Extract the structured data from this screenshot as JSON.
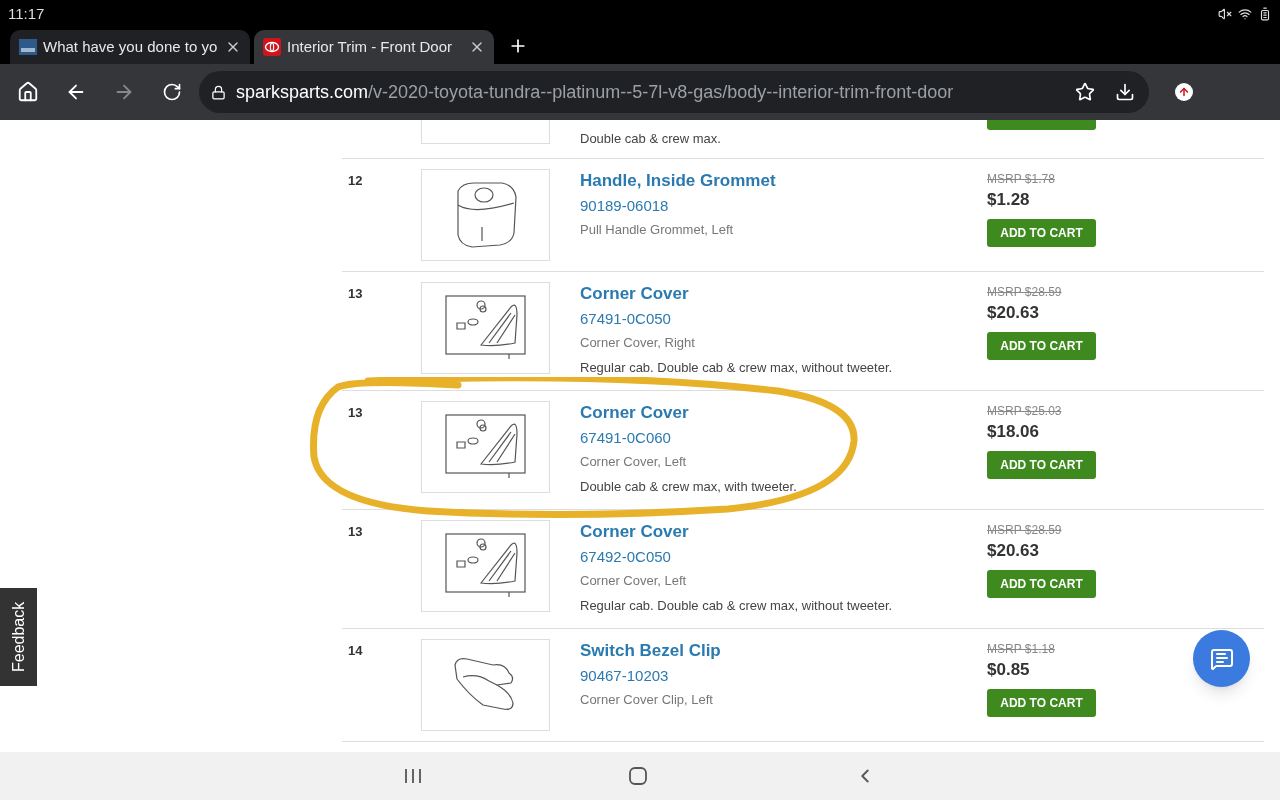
{
  "status_bar": {
    "time": "11:17"
  },
  "tabs": [
    {
      "title": "What have you done to yo",
      "kind": "forum",
      "selected": false
    },
    {
      "title": "Interior Trim - Front Door",
      "kind": "toyota",
      "selected": true
    }
  ],
  "address_bar": {
    "host": "sparksparts.com",
    "path": "/v-2020-toyota-tundra--platinum--5-7l-v8-gas/body--interior-trim-front-door"
  },
  "cut_row": {
    "note": "Double cab & crew max."
  },
  "parts": [
    {
      "number": "12",
      "kind": "grommet",
      "name": "Handle, Inside Grommet",
      "part_no": "90189-06018",
      "description": "Pull Handle Grommet, Left",
      "msrp": "MSRP $1.78",
      "price": "$1.28",
      "button": "ADD TO CART",
      "highlighted": false
    },
    {
      "number": "13",
      "kind": "corner-cover",
      "name": "Corner Cover",
      "part_no": "67491-0C050",
      "description": "Corner Cover, Right",
      "note": "Regular cab. Double cab & crew max, without tweeter.",
      "msrp": "MSRP $28.59",
      "price": "$20.63",
      "button": "ADD TO CART",
      "highlighted": false
    },
    {
      "number": "13",
      "kind": "corner-cover",
      "name": "Corner Cover",
      "part_no": "67491-0C060",
      "description": "Corner Cover, Left",
      "note": "Double cab & crew max, with tweeter.",
      "msrp": "MSRP $25.03",
      "price": "$18.06",
      "button": "ADD TO CART",
      "highlighted": true
    },
    {
      "number": "13",
      "kind": "corner-cover",
      "name": "Corner Cover",
      "part_no": "67492-0C050",
      "description": "Corner Cover, Left",
      "note": "Regular cab. Double cab & crew max, without tweeter.",
      "msrp": "MSRP $28.59",
      "price": "$20.63",
      "button": "ADD TO CART",
      "highlighted": false
    },
    {
      "number": "14",
      "kind": "clip",
      "name": "Switch Bezel Clip",
      "part_no": "90467-10203",
      "description": "Corner Cover Clip, Left",
      "msrp": "MSRP $1.18",
      "price": "$0.85",
      "button": "ADD TO CART",
      "highlighted": false
    }
  ],
  "feedback": "Feedback"
}
